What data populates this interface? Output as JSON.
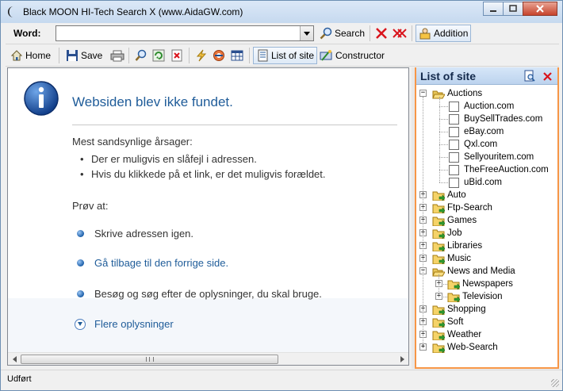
{
  "window": {
    "title": "Black MOON HI-Tech Search X (www.AidaGW.com)"
  },
  "word_bar": {
    "label": "Word:",
    "value": "",
    "search_label": "Search",
    "addition_label": "Addition"
  },
  "toolbar": {
    "home_label": "Home",
    "save_label": "Save",
    "list_of_site_label": "List of site",
    "constructor_label": "Constructor"
  },
  "page": {
    "title": "Websiden blev ikke fundet.",
    "causes_heading": "Mest sandsynlige årsager:",
    "causes": [
      "Der er muligvis en slåfejl i adressen.",
      "Hvis du klikkede på et link, er det muligvis forældet."
    ],
    "try_heading": "Prøv at:",
    "try_items": [
      "Skrive adressen igen.",
      "Gå tilbage til den forrige side.",
      "Besøg  og søg efter de oplysninger, du skal bruge."
    ],
    "more_info": "Flere oplysninger"
  },
  "panel": {
    "title": "List of site",
    "tree": [
      {
        "label": "Auctions",
        "expanded": true,
        "children": [
          "Auction.com",
          "BuySellTrades.com",
          "eBay.com",
          "Qxl.com",
          "Sellyouritem.com",
          "TheFreeAuction.com",
          "uBid.com"
        ]
      },
      {
        "label": "Auto",
        "expanded": false
      },
      {
        "label": "Ftp-Search",
        "expanded": false
      },
      {
        "label": "Games",
        "expanded": false
      },
      {
        "label": "Job",
        "expanded": false
      },
      {
        "label": "Libraries",
        "expanded": false
      },
      {
        "label": "Music",
        "expanded": false
      },
      {
        "label": "News and Media",
        "expanded": true,
        "children": [
          "Newspapers",
          "Television"
        ]
      },
      {
        "label": "Shopping",
        "expanded": false
      },
      {
        "label": "Soft",
        "expanded": false
      },
      {
        "label": "Weather",
        "expanded": false
      },
      {
        "label": "Web-Search",
        "expanded": false
      }
    ]
  },
  "status": {
    "text": "Udført"
  },
  "colors": {
    "accent": "#1f5c99",
    "panel_border": "#f79646",
    "close_red": "#d9141c"
  }
}
